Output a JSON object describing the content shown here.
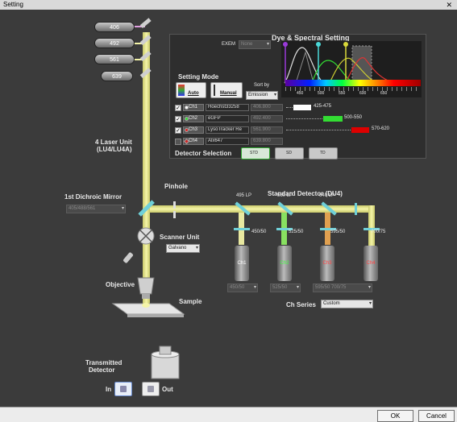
{
  "window": {
    "title": "Setting",
    "close_glyph": "✕"
  },
  "footer": {
    "ok": "OK",
    "cancel": "Cancel"
  },
  "lasers": [
    {
      "label": "406"
    },
    {
      "label": "492"
    },
    {
      "label": "561"
    },
    {
      "label": "639"
    }
  ],
  "laser_unit": {
    "line1": "4 Laser Unit",
    "line2": "(LU4/LU4A)"
  },
  "dye": {
    "title": "Dye & Spectral Setting",
    "exem_label": "EXEM",
    "exem_value": "None",
    "setting_mode": "Setting Mode",
    "auto_label": "Auto",
    "manual_label": "Manual",
    "sort_by_label": "Sort by",
    "sort_by_value": "Emission",
    "axis_ticks": [
      "450",
      "500",
      "550",
      "600",
      "650"
    ],
    "channels": [
      {
        "ch": "Ch1",
        "dye": "Hoechst33258",
        "range": "406.800",
        "em": "425-475",
        "color": "#ffffff",
        "checked": true
      },
      {
        "ch": "Ch2",
        "dye": "eGFP",
        "range": "492.400",
        "em": "500-550",
        "color": "#33dd33",
        "checked": true
      },
      {
        "ch": "Ch3",
        "dye": "LysoTracker Re",
        "range": "561.900",
        "em": "570-620",
        "color": "#dd0000",
        "checked": true
      },
      {
        "ch": "Ch4",
        "dye": "Alx647",
        "range": "639.800",
        "em": "",
        "color": "#cc2222",
        "checked": false
      }
    ]
  },
  "detector_selection": {
    "label": "Detector Selection",
    "btn1": "STD",
    "btn2": "SD",
    "btn3": "TD"
  },
  "dichroic": {
    "label": "1st Dichroic Mirror",
    "value": "405/488/561"
  },
  "pinhole": {
    "label": "Pinhole"
  },
  "scanner": {
    "label": "Scanner Unit",
    "value": "Galvano"
  },
  "objective": {
    "label": "Objective"
  },
  "sample": {
    "label": "Sample"
  },
  "standard_detector": {
    "title": "Standard Detector (DU4)",
    "mirrors": [
      "495 LP",
      "560 LP",
      "640 LP"
    ],
    "filters": [
      "450/50",
      "525/50",
      "595/50",
      "700/75"
    ],
    "pmts": [
      {
        "label": "Ch1",
        "color": "#ffffff"
      },
      {
        "label": "Ch2",
        "color": "#44ff44"
      },
      {
        "label": "Ch3",
        "color": "#ff4444"
      },
      {
        "label": "Ch4",
        "color": "#ff4444"
      }
    ],
    "filter_selects": [
      "450/50",
      "525/50",
      "595/50 700/75"
    ]
  },
  "ch_series": {
    "label": "Ch Series",
    "value": "Custom"
  },
  "transmitted": {
    "line1": "Transmitted",
    "line2": "Detector",
    "in_label": "In",
    "out_label": "Out"
  }
}
